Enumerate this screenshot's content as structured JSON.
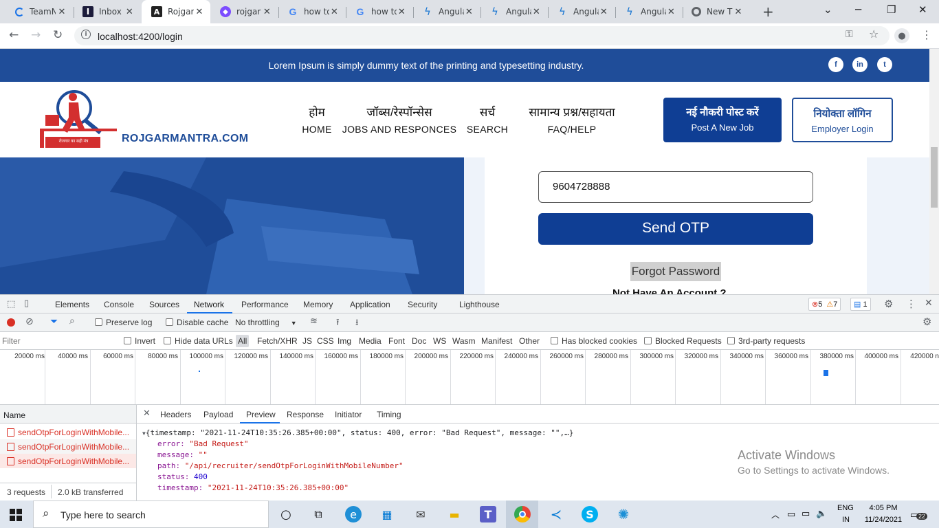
{
  "browser": {
    "tabs": [
      {
        "label": "TeamN",
        "icon": "spinner-icon"
      },
      {
        "label": "Inbox",
        "icon": "inbox-app-icon"
      },
      {
        "label": "Rojgar",
        "icon": "angular-icon",
        "active": true
      },
      {
        "label": "rojgar",
        "icon": "web-icon"
      },
      {
        "label": "how to",
        "icon": "google-icon"
      },
      {
        "label": "how to",
        "icon": "google-icon"
      },
      {
        "label": "Angula",
        "icon": "bolt-icon"
      },
      {
        "label": "Angula",
        "icon": "bolt-icon"
      },
      {
        "label": "Angula",
        "icon": "bolt-icon"
      },
      {
        "label": "Angula",
        "icon": "bolt-icon"
      },
      {
        "label": "New T",
        "icon": "chrome-icon"
      }
    ],
    "url": "localhost:4200/login"
  },
  "site": {
    "strip_text": "Lorem Ipsum is simply dummy text of the printing and typesetting industry.",
    "brand": "ROJGARMANTRA.COM",
    "logo_tagline": "रोजगार का सही मंत्र",
    "nav": [
      {
        "hi": "होम",
        "en": "HOME"
      },
      {
        "hi": "जॉब्स/रेस्पॉन्सेस",
        "en": "JOBS AND RESPONCES"
      },
      {
        "hi": "सर्च",
        "en": "SEARCH"
      },
      {
        "hi": "सामान्य प्रश्न/सहायता",
        "en": "FAQ/HELP"
      }
    ],
    "post_job": {
      "hi": "नई नौकरी पोस्ट करें",
      "en": "Post A New Job"
    },
    "employer_login": {
      "hi": "नियोक्ता लॉगिन",
      "en": "Employer Login"
    },
    "phone_value": "9604728888",
    "send_otp": "Send OTP",
    "forgot": "Forgot Password",
    "no_account": "Not Have An Account ?"
  },
  "devtools": {
    "tabs": [
      "Elements",
      "Console",
      "Sources",
      "Network",
      "Performance",
      "Memory",
      "Application",
      "Security",
      "Lighthouse"
    ],
    "active_tab": "Network",
    "errors": "5",
    "warnings": "7",
    "messages": "1",
    "preserve_log": "Preserve log",
    "disable_cache": "Disable cache",
    "throttling": "No throttling",
    "filter_placeholder": "Filter",
    "invert": "Invert",
    "hide_data_urls": "Hide data URLs",
    "types": [
      "All",
      "Fetch/XHR",
      "JS",
      "CSS",
      "Img",
      "Media",
      "Font",
      "Doc",
      "WS",
      "Wasm",
      "Manifest",
      "Other"
    ],
    "has_blocked_cookies": "Has blocked cookies",
    "blocked_requests": "Blocked Requests",
    "third_party": "3rd-party requests",
    "timeline_ticks": [
      "20000 ms",
      "40000 ms",
      "60000 ms",
      "80000 ms",
      "100000 ms",
      "120000 ms",
      "140000 ms",
      "160000 ms",
      "180000 ms",
      "200000 ms",
      "220000 ms",
      "240000 ms",
      "260000 ms",
      "280000 ms",
      "300000 ms",
      "320000 ms",
      "340000 ms",
      "360000 ms",
      "380000 ms",
      "400000 ms",
      "420000 n"
    ],
    "name_header": "Name",
    "requests": [
      "sendOtpForLoginWithMobile...",
      "sendOtpForLoginWithMobile...",
      "sendOtpForLoginWithMobile..."
    ],
    "summary_requests": "3 requests",
    "summary_transferred": "2.0 kB transferred",
    "detail_tabs": [
      "Headers",
      "Payload",
      "Preview",
      "Response",
      "Initiator",
      "Timing"
    ],
    "detail_active": "Preview",
    "preview": {
      "summary": "{timestamp: \"2021-11-24T10:35:26.385+00:00\", status: 400, error: \"Bad Request\", message: \"\",…}",
      "error_key": "error:",
      "error_val": "\"Bad Request\"",
      "message_key": "message:",
      "message_val": "\"\"",
      "path_key": "path:",
      "path_val": "\"/api/recruiter/sendOtpForLoginWithMobileNumber\"",
      "status_key": "status:",
      "status_val": "400",
      "timestamp_key": "timestamp:",
      "timestamp_val": "\"2021-11-24T10:35:26.385+00:00\""
    }
  },
  "watermark": {
    "title": "Activate Windows",
    "subtitle": "Go to Settings to activate Windows."
  },
  "taskbar": {
    "search_placeholder": "Type here to search",
    "lang1": "ENG",
    "lang2": "IN",
    "time": "4:05 PM",
    "date": "11/24/2021",
    "notifications": "22"
  }
}
